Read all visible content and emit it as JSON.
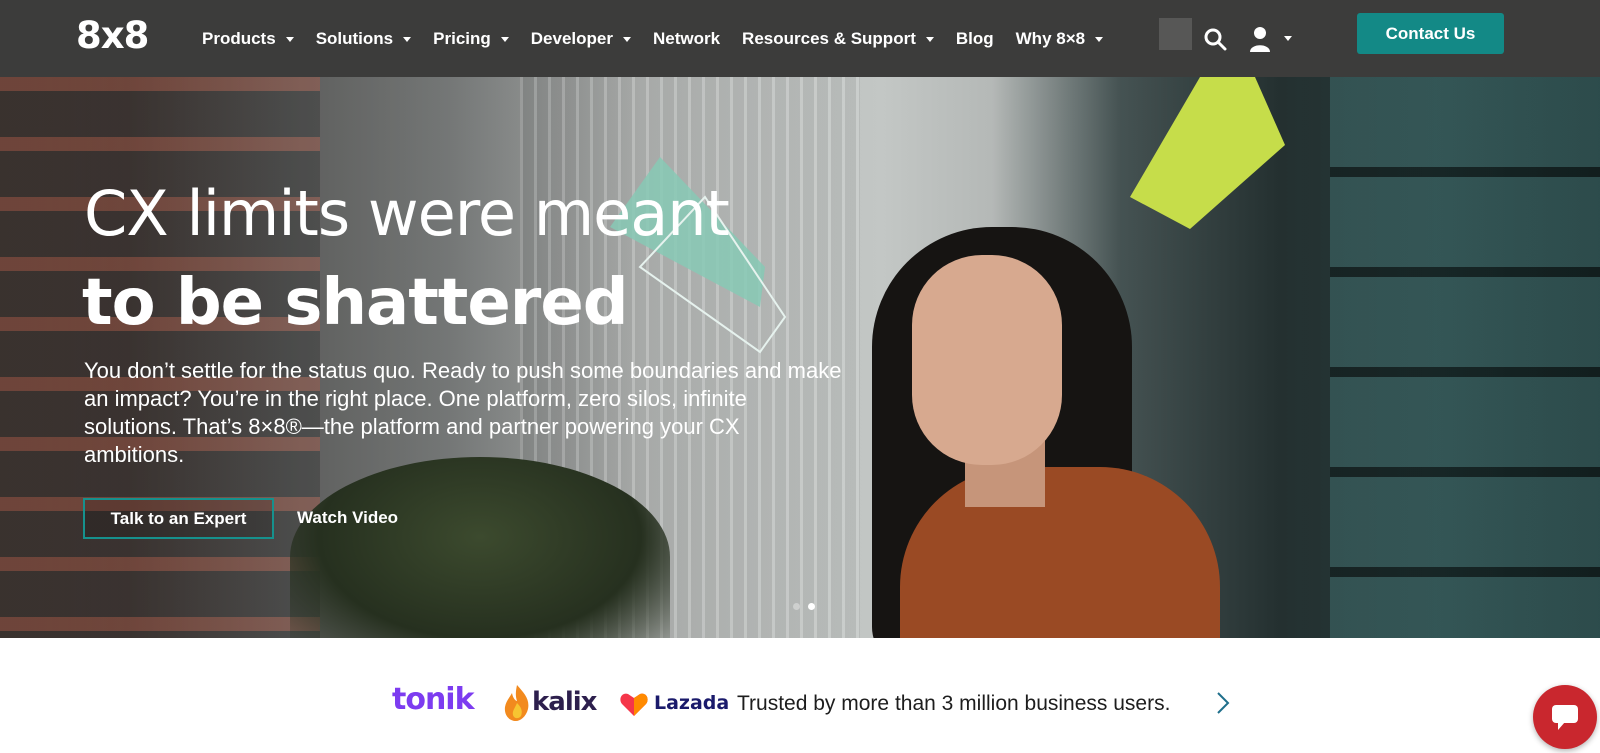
{
  "nav": {
    "logo": "8x8",
    "items": [
      {
        "label": "Products",
        "dropdown": true
      },
      {
        "label": "Solutions",
        "dropdown": true
      },
      {
        "label": "Pricing",
        "dropdown": true
      },
      {
        "label": "Developer",
        "dropdown": true
      },
      {
        "label": "Network",
        "dropdown": false
      },
      {
        "label": "Resources & Support",
        "dropdown": true
      },
      {
        "label": "Blog",
        "dropdown": false
      },
      {
        "label": "Why 8×8",
        "dropdown": true
      }
    ],
    "icons": {
      "search": "search-icon",
      "user": "user-icon"
    },
    "contact_label": "Contact Us"
  },
  "hero": {
    "title_line1": "CX limits were meant",
    "title_line2": "to be shattered",
    "subtitle": "You don’t settle for the status quo. Ready to push some boundaries and make an impact? You’re in the right place. One platform, zero silos, infinite solutions. That’s 8×8®—the platform and partner powering your CX ambitions.",
    "primary_button": "Talk to an Expert",
    "secondary_button": "Watch Video",
    "carousel": {
      "total_slides": 2,
      "active_slide": 2
    }
  },
  "trust": {
    "logos": [
      "tonik",
      "kalix",
      "Lazada"
    ],
    "text": "Trusted by more than 3 million business users."
  },
  "colors": {
    "nav_bg": "#3c3c3b",
    "accent_teal": "#138986",
    "lime": "#c6dd4a",
    "chat_red": "#c9272e"
  }
}
